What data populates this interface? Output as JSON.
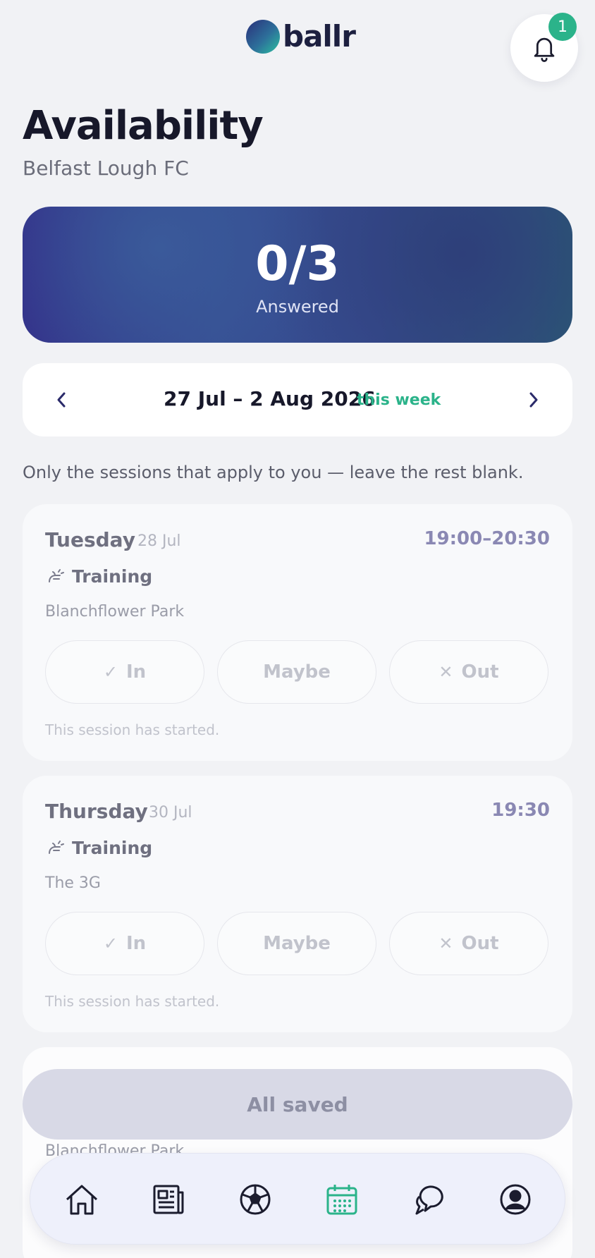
{
  "app": {
    "brand": "ballr",
    "notification_count": "1"
  },
  "page": {
    "title": "Availability",
    "subtitle": "Belfast Lough FC"
  },
  "summary": {
    "count": "0/3",
    "label": "Answered"
  },
  "week": {
    "range": "27 Jul – 2 Aug 2026",
    "tag": "this week"
  },
  "hint": "Only the sessions that apply to you — leave the rest blank.",
  "sessions": [
    {
      "day": "Tuesday",
      "date": "28 Jul",
      "time": "19:00–20:30",
      "type": "Training",
      "venue": "Blanchflower Park",
      "options": {
        "in": "In",
        "maybe": "Maybe",
        "out": "Out"
      },
      "note": "This session has started."
    },
    {
      "day": "Thursday",
      "date": "30 Jul",
      "time": "19:30",
      "type": "Training",
      "venue": "The 3G",
      "options": {
        "in": "In",
        "maybe": "Maybe",
        "out": "Out"
      },
      "note": "This session has started."
    },
    {
      "venue": "Blanchflower Park"
    }
  ],
  "save_button": "All saved",
  "nav": {
    "items": [
      "home-icon",
      "news-icon",
      "matches-icon",
      "calendar-icon",
      "chat-icon",
      "profile-icon"
    ],
    "active": "calendar-icon"
  },
  "colors": {
    "accent": "#2bb38a",
    "primary": "#34318a",
    "text": "#17182a"
  }
}
